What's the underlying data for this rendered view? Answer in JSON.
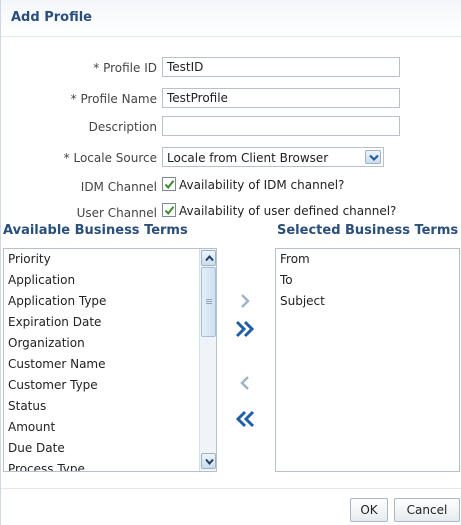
{
  "dialog": {
    "title": "Add Profile"
  },
  "form": {
    "profile_id": {
      "label": "* Profile ID",
      "value": "TestID"
    },
    "profile_name": {
      "label": "* Profile Name",
      "value": "TestProfile"
    },
    "description": {
      "label": "Description",
      "value": ""
    },
    "locale_source": {
      "label": "* Locale Source",
      "value": "Locale from Client Browser"
    },
    "idm_channel": {
      "label": "IDM Channel",
      "checkbox_text": "Availability of IDM channel?",
      "checked": true
    },
    "user_channel": {
      "label": "User Channel",
      "checkbox_text": "Availability of user defined channel?",
      "checked": true
    }
  },
  "available": {
    "heading": "Available Business Terms",
    "items": [
      "Priority",
      "Application",
      "Application Type",
      "Expiration Date",
      "Organization",
      "Customer Name",
      "Customer Type",
      "Status",
      "Amount",
      "Due Date",
      "Process Type"
    ]
  },
  "selected": {
    "heading": "Selected Business Terms",
    "items": [
      "From",
      "To",
      "Subject"
    ]
  },
  "icons": {
    "move": "chevron-right-icon",
    "move_all": "double-chevron-right-icon",
    "remove": "chevron-left-icon",
    "remove_all": "double-chevron-left-icon"
  },
  "buttons": {
    "ok": "OK",
    "cancel": "Cancel"
  },
  "colors": {
    "heading": "#2a4f7a",
    "accent": "#1f5fa8",
    "check": "#3a8a2a"
  }
}
